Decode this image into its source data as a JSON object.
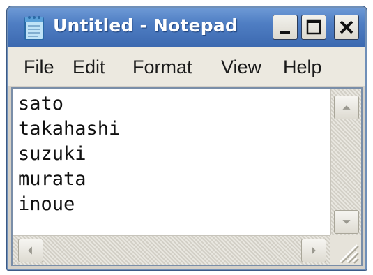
{
  "window": {
    "title": "Untitled - Notepad",
    "icon": "notepad-icon",
    "controls": {
      "minimize_icon": "minimize-icon",
      "maximize_icon": "maximize-icon",
      "close_icon": "close-icon"
    }
  },
  "menu": {
    "items": [
      {
        "label": "File"
      },
      {
        "label": "Edit"
      },
      {
        "label": "Format"
      },
      {
        "label": "View"
      },
      {
        "label": "Help"
      }
    ]
  },
  "editor": {
    "lines": [
      "sato",
      "takahashi",
      "suzuki",
      "murata",
      "inoue"
    ]
  },
  "colors": {
    "titlebar": "#4f7ec3",
    "title_text": "#ffffff",
    "editor_background": "#ffffff",
    "chrome": "#ece9e0"
  }
}
